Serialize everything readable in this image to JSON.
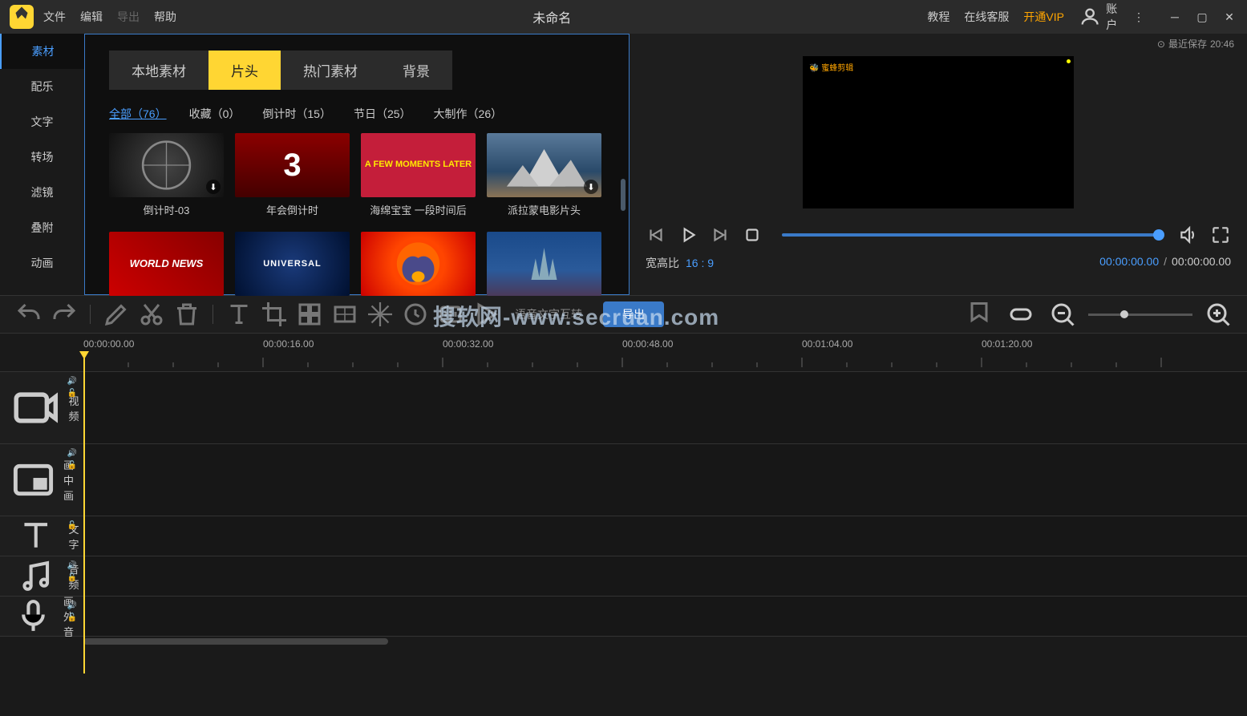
{
  "titlebar": {
    "menu": [
      "文件",
      "编辑",
      "导出",
      "帮助"
    ],
    "title": "未命名",
    "tutorial": "教程",
    "service": "在线客服",
    "vip": "开通VIP",
    "account": "账户",
    "last_save_label": "最近保存",
    "last_save_time": "20:46"
  },
  "sidebar": [
    "素材",
    "配乐",
    "文字",
    "转场",
    "滤镜",
    "叠附",
    "动画"
  ],
  "media": {
    "tabs": [
      "本地素材",
      "片头",
      "热门素材",
      "背景"
    ],
    "subtabs": [
      "全部（76）",
      "收藏（0）",
      "倒计时（15）",
      "节日（25）",
      "大制作（26）"
    ],
    "thumbs_row1": [
      "倒计时-03",
      "年会倒计时",
      "海绵宝宝 一段时间后",
      "派拉蒙电影片头"
    ],
    "thumb_texts": [
      "",
      "3",
      "A FEW MOMENTS LATER",
      ""
    ],
    "thumbs_row2_alt": [
      "WORLD NEWS",
      "UNIVERSAL",
      "",
      ""
    ]
  },
  "preview": {
    "logo_text": "蜜蜂剪辑",
    "aspect_label": "宽高比",
    "aspect_value": "16 : 9",
    "time_current": "00:00:00.00",
    "time_total": "00:00:00.00"
  },
  "toolbar": {
    "voice_text": "语音文字互转",
    "export": "导出"
  },
  "timeline": {
    "marks": [
      "00:00:00.00",
      "00:00:16.00",
      "00:00:32.00",
      "00:00:48.00",
      "00:01:04.00",
      "00:01:20.00"
    ],
    "tracks": [
      "视频",
      "画中画",
      "文字",
      "音频",
      "画外音"
    ]
  },
  "watermark": "搜软网-www.secruan.com"
}
